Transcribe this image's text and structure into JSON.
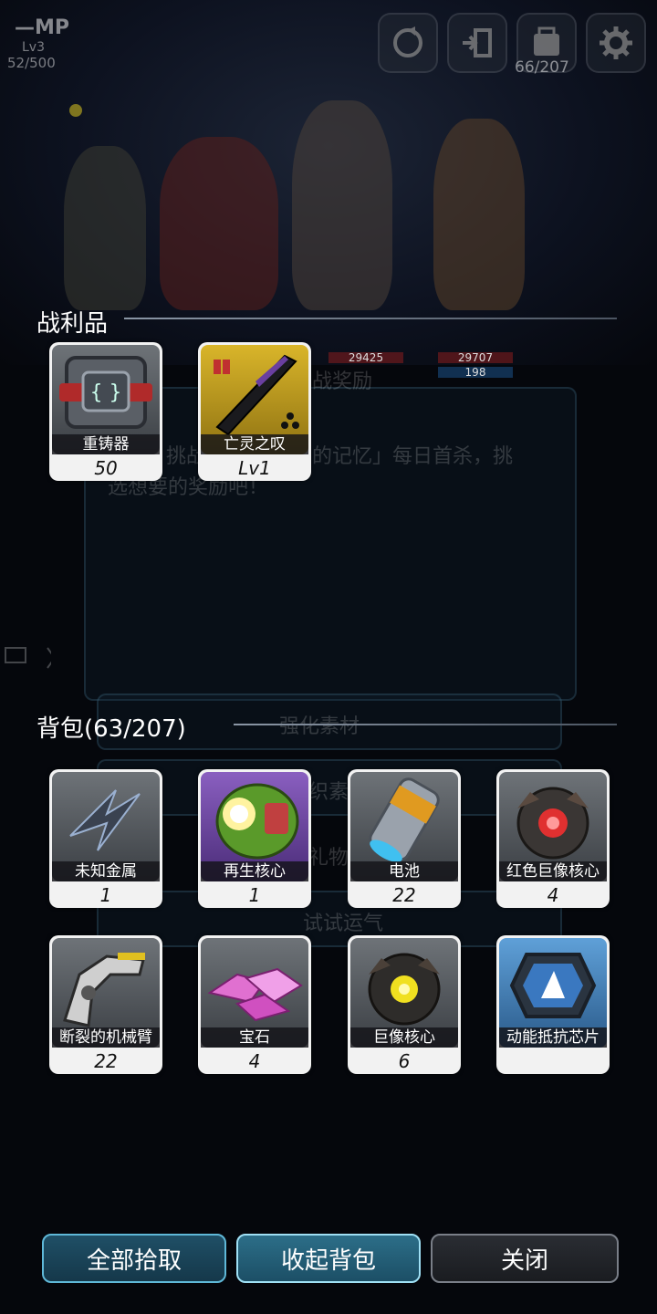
{
  "hud": {
    "mp_logo": "MP",
    "level": "Lv3",
    "mp_progress": "52/500",
    "bag_capacity": "66/207",
    "icons": [
      "refresh-icon",
      "exit-icon",
      "bag-icon",
      "gear-icon"
    ]
  },
  "background": {
    "hp_values": [
      "29425",
      "29707",
      "198"
    ],
    "ghost_texts": [
      "战奖励",
      "挑战",
      "的记忆」每日首杀，挑",
      "选想要的奖励吧！",
      "强化素材",
      "织素",
      "礼物",
      "试试运气"
    ]
  },
  "loot": {
    "title": "战利品",
    "items": [
      {
        "name": "重铸器",
        "count": "50",
        "rarity": "gray",
        "icon": "reforger-icon"
      },
      {
        "name": "亡灵之叹",
        "count": "Lv1",
        "rarity": "gold",
        "icon": "undead-sword-icon"
      }
    ]
  },
  "backpack": {
    "title": "背包(63/207)",
    "items": [
      {
        "name": "未知金属",
        "count": "1",
        "rarity": "gray",
        "icon": "unknown-metal-icon"
      },
      {
        "name": "再生核心",
        "count": "1",
        "rarity": "purple",
        "icon": "regen-core-icon"
      },
      {
        "name": "电池",
        "count": "22",
        "rarity": "gray",
        "icon": "battery-icon"
      },
      {
        "name": "红色巨像核心",
        "count": "4",
        "rarity": "gray",
        "icon": "red-colossus-core-icon"
      },
      {
        "name": "断裂的机械臂",
        "count": "22",
        "rarity": "gray",
        "icon": "broken-mech-arm-icon"
      },
      {
        "name": "宝石",
        "count": "4",
        "rarity": "gray",
        "icon": "gem-icon"
      },
      {
        "name": "巨像核心",
        "count": "6",
        "rarity": "gray",
        "icon": "colossus-core-icon"
      },
      {
        "name": "动能抵抗芯片",
        "count": "",
        "rarity": "blue",
        "icon": "kinetic-chip-icon"
      }
    ]
  },
  "buttons": {
    "pickup_all": "全部拾取",
    "close_bag": "收起背包",
    "close": "关闭"
  },
  "colors": {
    "accent": "#5fb8d8",
    "card_bg": "#f2f2f2",
    "gold": "#d9b52a",
    "purple": "#8a5fc0",
    "blue": "#5fa0d8"
  }
}
